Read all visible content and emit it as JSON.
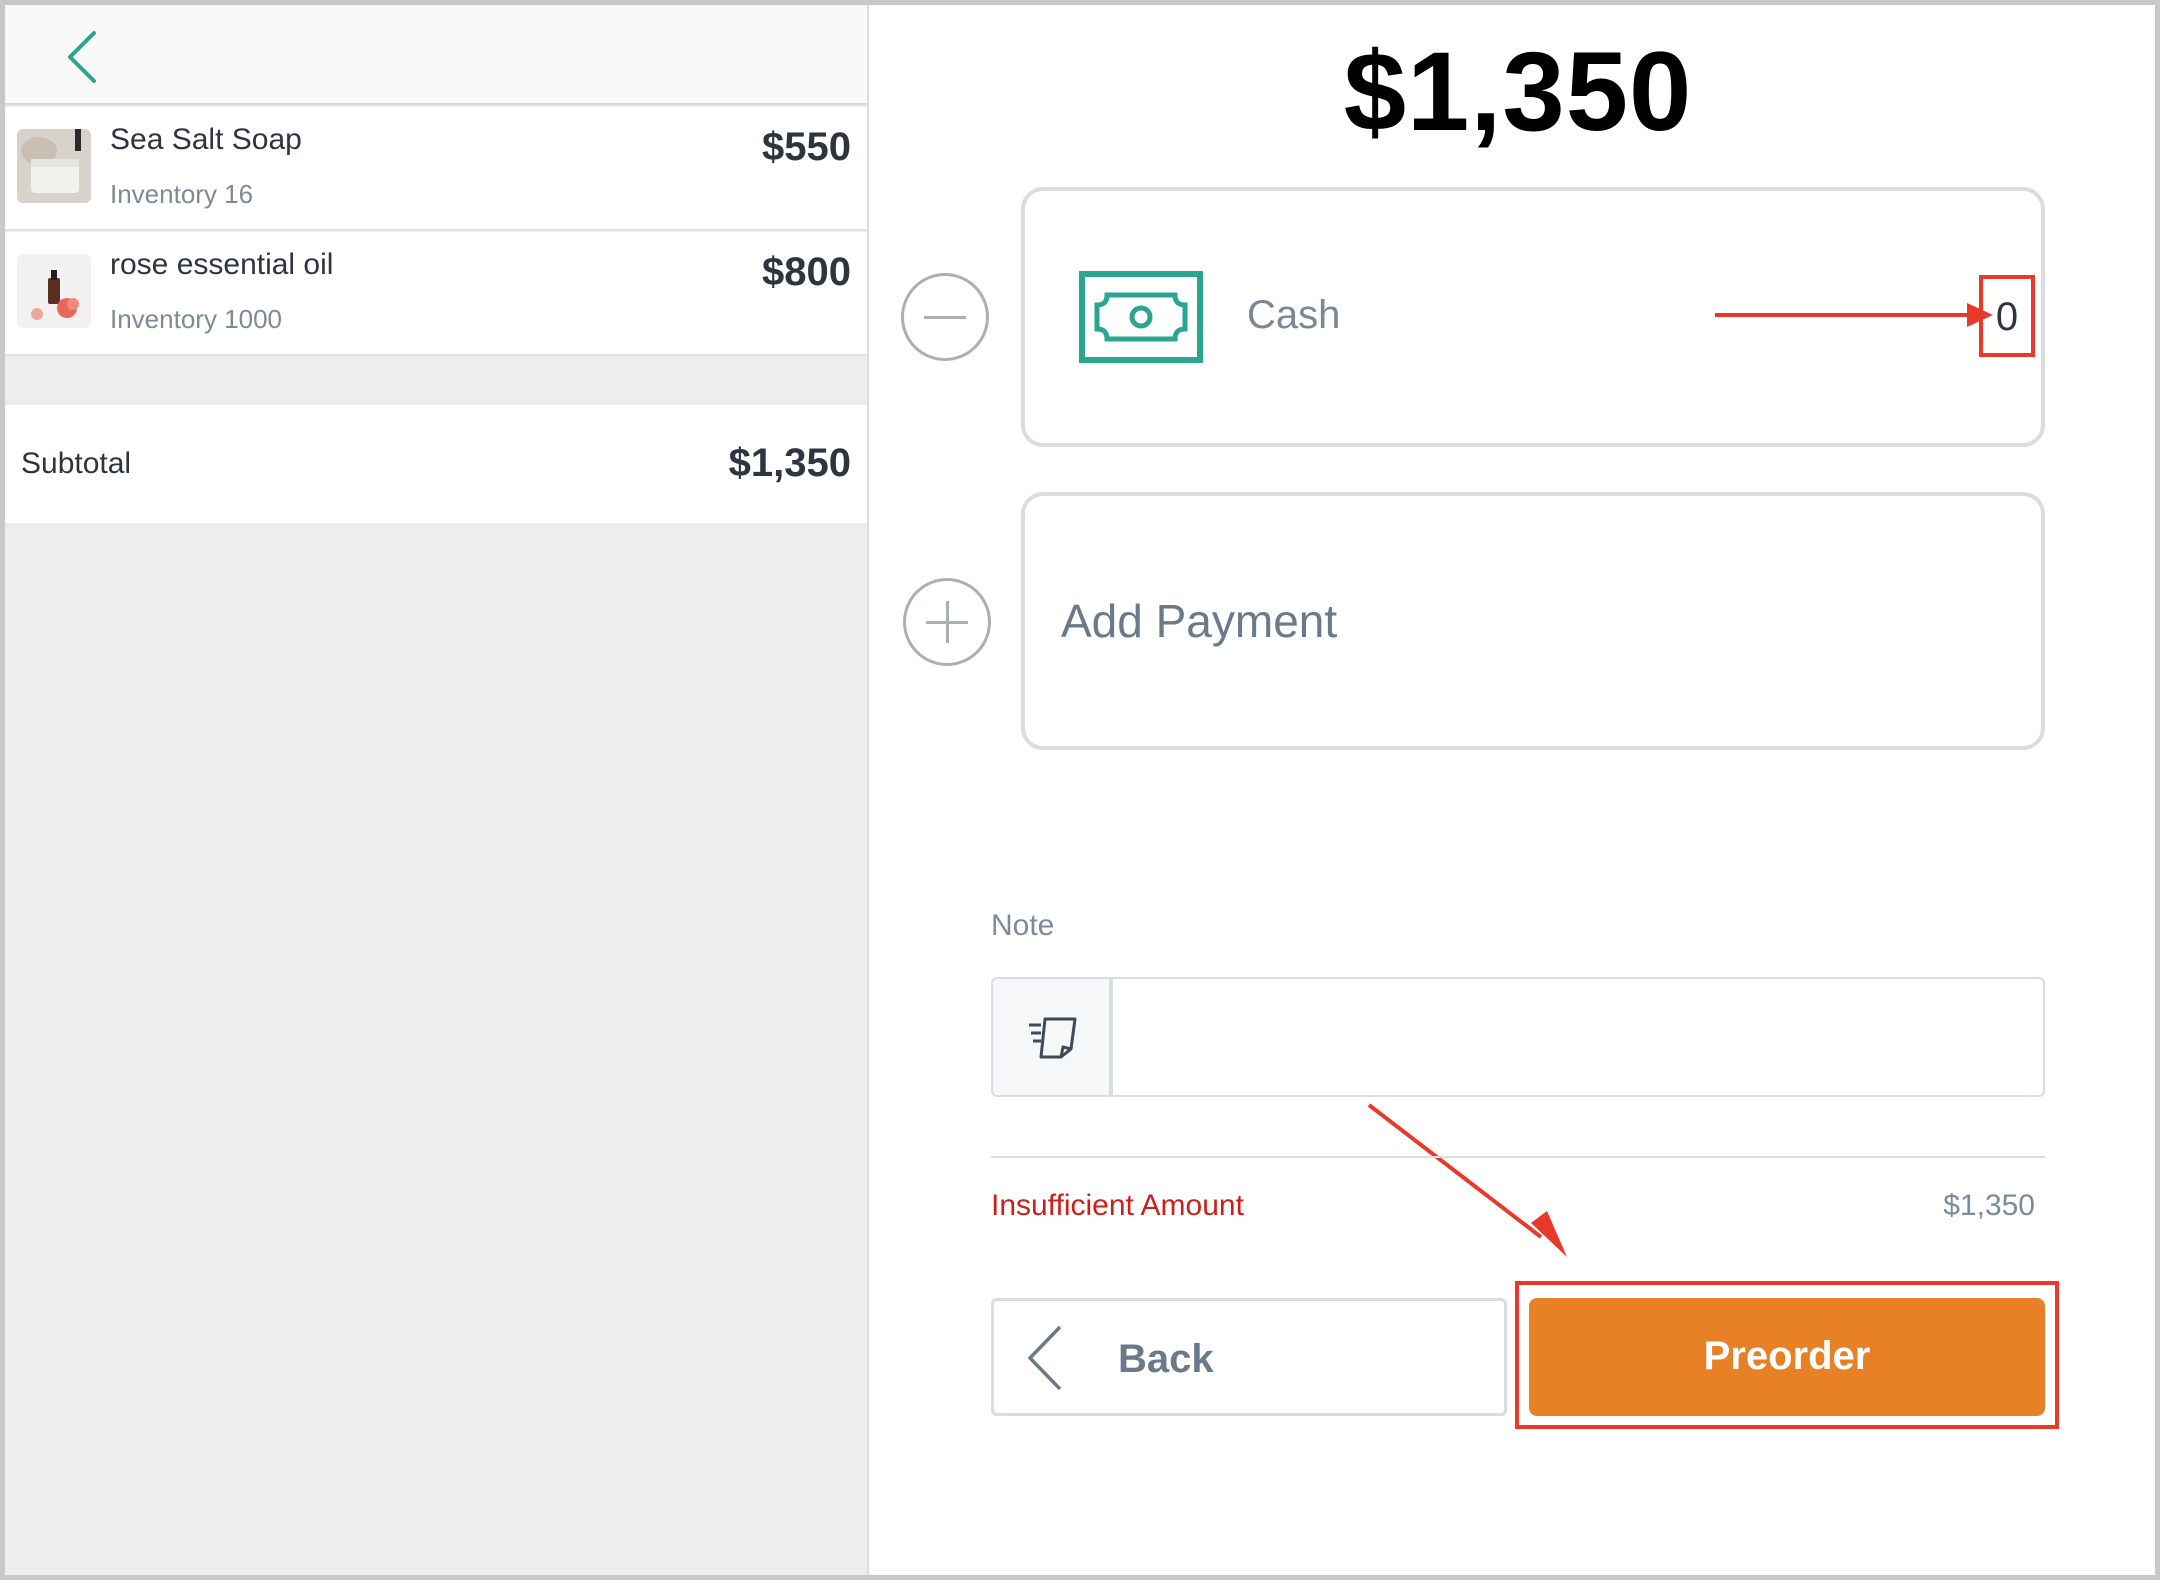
{
  "cart": {
    "items": [
      {
        "name": "Sea Salt Soap",
        "inventory": "Inventory 16",
        "price": "$550",
        "thumb_icon": "soap-thumbnail"
      },
      {
        "name": "rose essential oil",
        "inventory": "Inventory 1000",
        "price": "$800",
        "thumb_icon": "essential-oil-thumbnail"
      }
    ],
    "subtotal_label": "Subtotal",
    "subtotal_value": "$1,350"
  },
  "checkout": {
    "total": "$1,350",
    "payments": [
      {
        "method": "Cash",
        "amount": "0",
        "icon": "cash-icon"
      }
    ],
    "add_payment_label": "Add Payment",
    "note_label": "Note",
    "note_value": "",
    "status_label": "Insufficient Amount",
    "status_amount": "$1,350",
    "back_label": "Back",
    "preorder_label": "Preorder"
  },
  "colors": {
    "accent": "#2ba58f",
    "preorder": "#e88125",
    "error": "#cc1f1a",
    "annotation": "#e8392a"
  }
}
